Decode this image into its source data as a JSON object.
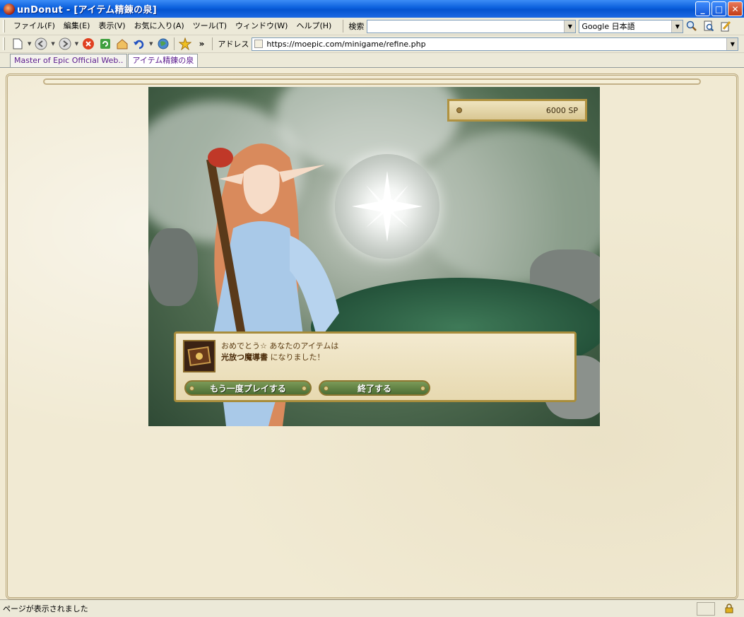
{
  "window": {
    "title": "unDonut - [アイテム精錬の泉]"
  },
  "menu": [
    "ファイル(F)",
    "編集(E)",
    "表示(V)",
    "お気に入り(A)",
    "ツール(T)",
    "ウィンドウ(W)",
    "ヘルプ(H)"
  ],
  "search": {
    "label": "検索",
    "value": "",
    "engine": "Google 日本語"
  },
  "address": {
    "label": "アドレス",
    "url": "https://moepic.com/minigame/refine.php"
  },
  "tabs": [
    {
      "label": "Master of Epic Official Web..",
      "active": false
    },
    {
      "label": "アイテム精錬の泉",
      "active": true
    }
  ],
  "game": {
    "sp": "6000  SP",
    "message_line1": "おめでとう☆ あなたのアイテムは",
    "item_name": "光放つ魔導書",
    "message_line2_suffix": " になりました！",
    "retry_button": "もう一度プレイする",
    "exit_button": "終了する"
  },
  "status": {
    "text": "ページが表示されました"
  },
  "colors": {
    "titlebar": "#0554d0",
    "page_bg": "#f1ead3",
    "button_green": "#4c6e34",
    "frame_gold": "#a88d3c"
  }
}
